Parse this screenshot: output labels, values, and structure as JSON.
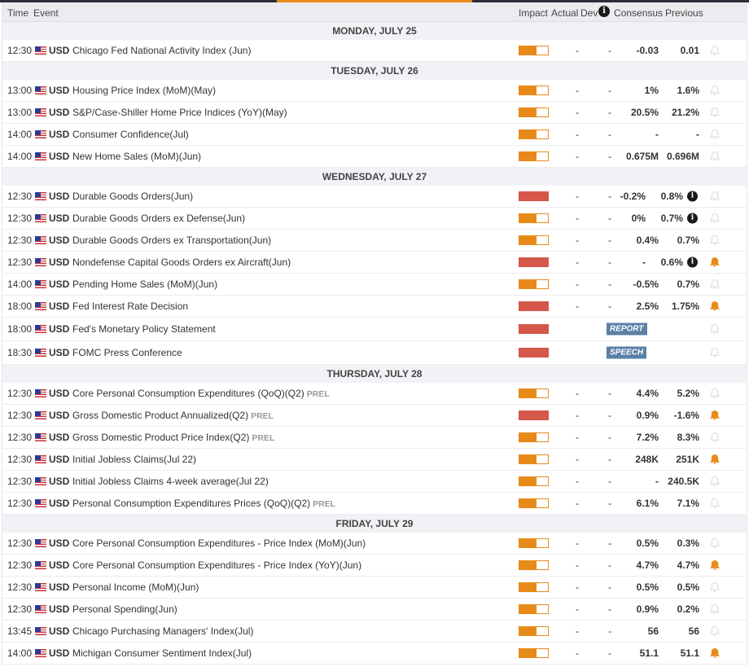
{
  "header": {
    "time": "Time",
    "event": "Event",
    "impact": "Impact",
    "actual": "Actual",
    "dev": "Dev",
    "info": "i",
    "consensus": "Consensus",
    "previous": "Previous"
  },
  "colors": {
    "medium": "#e88a1a",
    "high": "#d5574a",
    "badge": "#5b80a5",
    "alert_on": "#e88a1a",
    "alert_off": "#d8d8d8"
  },
  "days": [
    {
      "label": "MONDAY, JULY 25",
      "events": [
        {
          "time": "12:30",
          "currency": "USD",
          "name": "Chicago Fed National Activity Index (Jun)",
          "impact": "medium",
          "actual": "-",
          "dev": "-",
          "consensus": "-0.03",
          "previous": "0.01",
          "alert": false
        }
      ]
    },
    {
      "label": "TUESDAY, JULY 26",
      "events": [
        {
          "time": "13:00",
          "currency": "USD",
          "name": "Housing Price Index (MoM)(May)",
          "impact": "medium",
          "actual": "-",
          "dev": "-",
          "consensus": "1%",
          "previous": "1.6%",
          "alert": false
        },
        {
          "time": "13:00",
          "currency": "USD",
          "name": "S&P/Case-Shiller Home Price Indices (YoY)(May)",
          "impact": "medium",
          "actual": "-",
          "dev": "-",
          "consensus": "20.5%",
          "previous": "21.2%",
          "alert": false
        },
        {
          "time": "14:00",
          "currency": "USD",
          "name": "Consumer Confidence(Jul)",
          "impact": "medium",
          "actual": "-",
          "dev": "-",
          "consensus": "-",
          "previous": "-",
          "alert": false
        },
        {
          "time": "14:00",
          "currency": "USD",
          "name": "New Home Sales (MoM)(Jun)",
          "impact": "medium",
          "actual": "-",
          "dev": "-",
          "consensus": "0.675M",
          "previous": "0.696M",
          "alert": false
        }
      ]
    },
    {
      "label": "WEDNESDAY, JULY 27",
      "events": [
        {
          "time": "12:30",
          "currency": "USD",
          "name": "Durable Goods Orders(Jun)",
          "impact": "high",
          "actual": "-",
          "dev": "-",
          "consensus": "-0.2%",
          "previous": "0.8%",
          "info": "i",
          "alert": false
        },
        {
          "time": "12:30",
          "currency": "USD",
          "name": "Durable Goods Orders ex Defense(Jun)",
          "impact": "medium",
          "actual": "-",
          "dev": "-",
          "consensus": "0%",
          "previous": "0.7%",
          "info": "i",
          "alert": false
        },
        {
          "time": "12:30",
          "currency": "USD",
          "name": "Durable Goods Orders ex Transportation(Jun)",
          "impact": "medium",
          "actual": "-",
          "dev": "-",
          "consensus": "0.4%",
          "previous": "0.7%",
          "alert": false
        },
        {
          "time": "12:30",
          "currency": "USD",
          "name": "Nondefense Capital Goods Orders ex Aircraft(Jun)",
          "impact": "high",
          "actual": "-",
          "dev": "-",
          "consensus": "-",
          "previous": "0.6%",
          "info": "i",
          "alert": true
        },
        {
          "time": "14:00",
          "currency": "USD",
          "name": "Pending Home Sales (MoM)(Jun)",
          "impact": "medium",
          "actual": "-",
          "dev": "-",
          "consensus": "-0.5%",
          "previous": "0.7%",
          "alert": false
        },
        {
          "time": "18:00",
          "currency": "USD",
          "name": "Fed Interest Rate Decision",
          "impact": "high",
          "actual": "-",
          "dev": "-",
          "consensus": "2.5%",
          "previous": "1.75%",
          "alert": true
        },
        {
          "time": "18:00",
          "currency": "USD",
          "name": "Fed's Monetary Policy Statement",
          "impact": "high",
          "badge": "REPORT",
          "alert": false
        },
        {
          "time": "18:30",
          "currency": "USD",
          "name": "FOMC Press Conference",
          "impact": "high",
          "badge": "SPEECH",
          "alert": false
        }
      ]
    },
    {
      "label": "THURSDAY, JULY 28",
      "events": [
        {
          "time": "12:30",
          "currency": "USD",
          "name": "Core Personal Consumption Expenditures (QoQ)(Q2)",
          "prel": "PREL",
          "impact": "medium",
          "actual": "-",
          "dev": "-",
          "consensus": "4.4%",
          "previous": "5.2%",
          "alert": false
        },
        {
          "time": "12:30",
          "currency": "USD",
          "name": "Gross Domestic Product Annualized(Q2)",
          "prel": "PREL",
          "impact": "high",
          "actual": "-",
          "dev": "-",
          "consensus": "0.9%",
          "previous": "-1.6%",
          "alert": true
        },
        {
          "time": "12:30",
          "currency": "USD",
          "name": "Gross Domestic Product Price Index(Q2)",
          "prel": "PREL",
          "impact": "medium",
          "actual": "-",
          "dev": "-",
          "consensus": "7.2%",
          "previous": "8.3%",
          "alert": false
        },
        {
          "time": "12:30",
          "currency": "USD",
          "name": "Initial Jobless Claims(Jul 22)",
          "impact": "medium",
          "actual": "-",
          "dev": "-",
          "consensus": "248K",
          "previous": "251K",
          "alert": true
        },
        {
          "time": "12:30",
          "currency": "USD",
          "name": "Initial Jobless Claims 4-week average(Jul 22)",
          "impact": "medium",
          "actual": "-",
          "dev": "-",
          "consensus": "-",
          "previous": "240.5K",
          "alert": false
        },
        {
          "time": "12:30",
          "currency": "USD",
          "name": "Personal Consumption Expenditures Prices (QoQ)(Q2)",
          "prel": "PREL",
          "impact": "medium",
          "actual": "-",
          "dev": "-",
          "consensus": "6.1%",
          "previous": "7.1%",
          "alert": false
        }
      ]
    },
    {
      "label": "FRIDAY, JULY 29",
      "events": [
        {
          "time": "12:30",
          "currency": "USD",
          "name": "Core Personal Consumption Expenditures - Price Index (MoM)(Jun)",
          "impact": "medium",
          "actual": "-",
          "dev": "-",
          "consensus": "0.5%",
          "previous": "0.3%",
          "alert": false
        },
        {
          "time": "12:30",
          "currency": "USD",
          "name": "Core Personal Consumption Expenditures - Price Index (YoY)(Jun)",
          "impact": "medium",
          "actual": "-",
          "dev": "-",
          "consensus": "4.7%",
          "previous": "4.7%",
          "alert": true
        },
        {
          "time": "12:30",
          "currency": "USD",
          "name": "Personal Income (MoM)(Jun)",
          "impact": "medium",
          "actual": "-",
          "dev": "-",
          "consensus": "0.5%",
          "previous": "0.5%",
          "alert": false
        },
        {
          "time": "12:30",
          "currency": "USD",
          "name": "Personal Spending(Jun)",
          "impact": "medium",
          "actual": "-",
          "dev": "-",
          "consensus": "0.9%",
          "previous": "0.2%",
          "alert": false
        },
        {
          "time": "13:45",
          "currency": "USD",
          "name": "Chicago Purchasing Managers' Index(Jul)",
          "impact": "medium",
          "actual": "-",
          "dev": "-",
          "consensus": "56",
          "previous": "56",
          "alert": false
        },
        {
          "time": "14:00",
          "currency": "USD",
          "name": "Michigan Consumer Sentiment Index(Jul)",
          "impact": "medium",
          "actual": "-",
          "dev": "-",
          "consensus": "51.1",
          "previous": "51.1",
          "alert": true
        }
      ]
    }
  ]
}
